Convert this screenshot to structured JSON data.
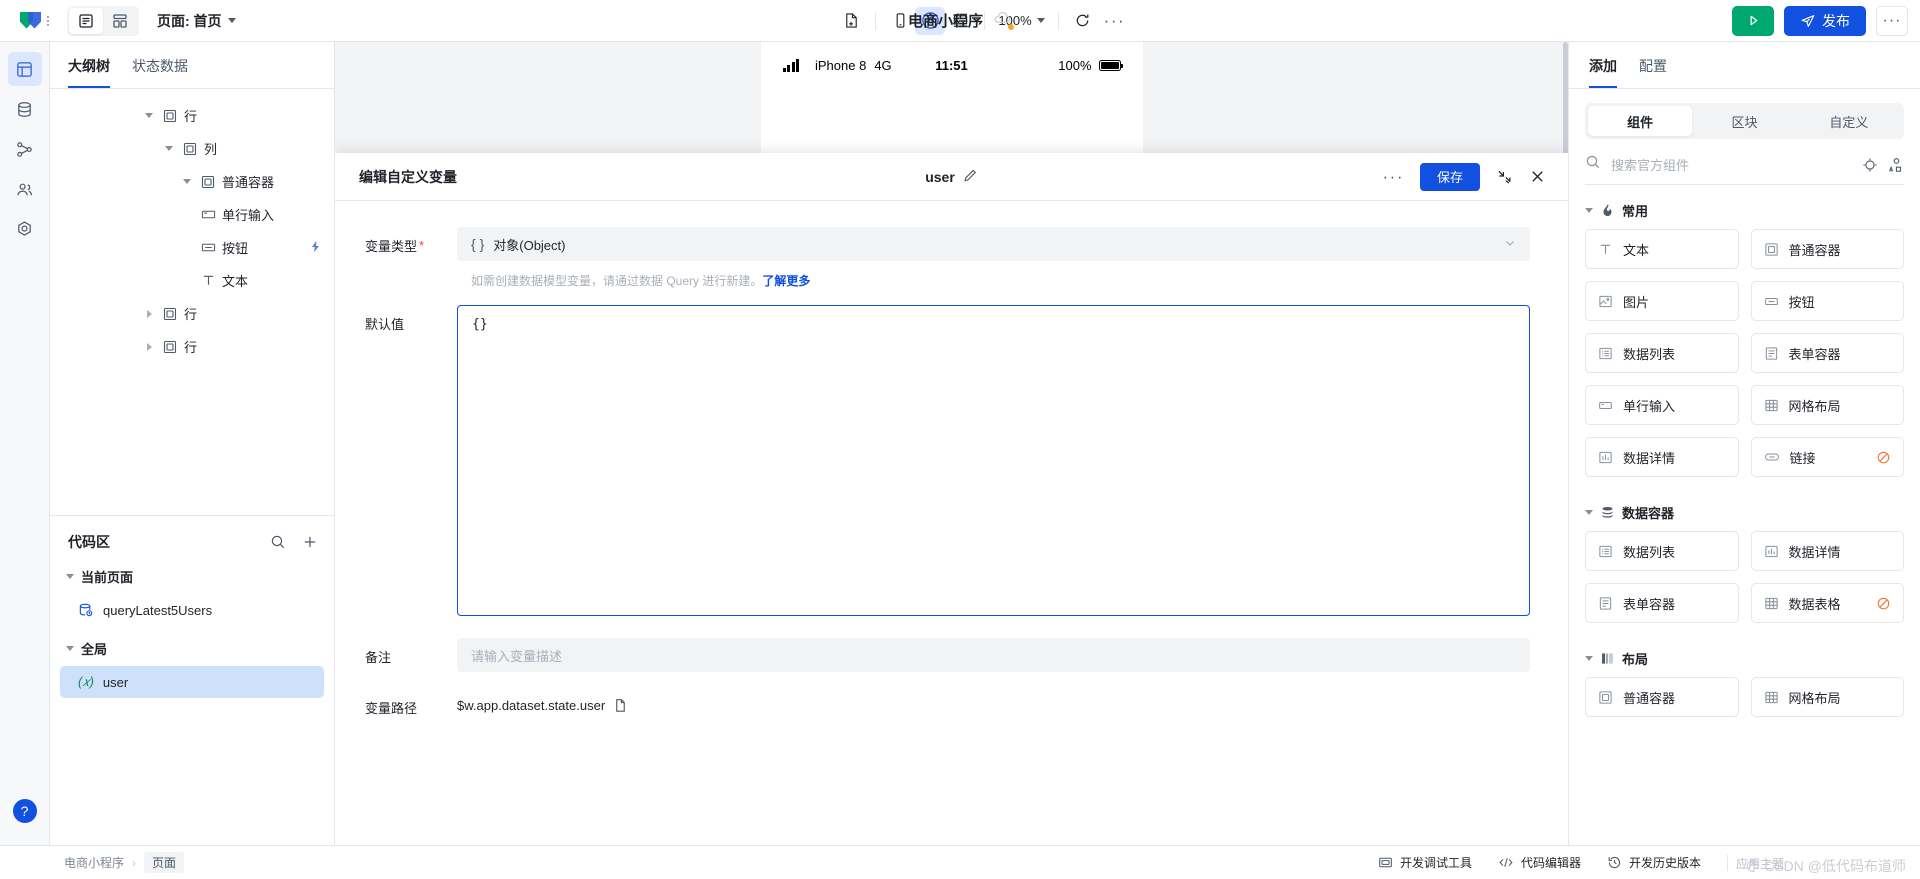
{
  "topbar": {
    "logo_icon": "logo-icon",
    "menu_dots_icon": "menu-dots-icon",
    "view_outline_icon": "view-outline-icon",
    "view_grid_icon": "view-grid-icon",
    "page_label": "页面: 首页",
    "new_page_icon": "new-page-icon",
    "device_mobile_icon": "device-mobile-icon",
    "device_miniapp_icon": "device-miniapp-icon",
    "device_desktop_icon": "device-desktop-icon",
    "zoom_level": "100%",
    "refresh_icon": "refresh-icon",
    "more_icon": "more-horizontal-icon",
    "app_title": "电商小程序",
    "cloud_icon": "cloud-icon",
    "run_icon": "play-icon",
    "publish_label": "发布",
    "publish_icon": "send-icon",
    "more_square_icon": "more-horizontal-icon"
  },
  "rail": {
    "items": [
      {
        "name": "pages",
        "icon": "pages-icon",
        "active": true
      },
      {
        "name": "data",
        "icon": "database-icon",
        "active": false
      },
      {
        "name": "flows",
        "icon": "workflow-icon",
        "active": false
      },
      {
        "name": "users",
        "icon": "users-icon",
        "active": false
      },
      {
        "name": "settings",
        "icon": "hexagon-settings-icon",
        "active": false
      }
    ],
    "help_label": "?"
  },
  "left_panel": {
    "tabs": [
      {
        "label": "大纲树",
        "active": true
      },
      {
        "label": "状态数据",
        "active": false
      }
    ],
    "tree": [
      {
        "label": "行",
        "icon": "container-icon",
        "indent": 1,
        "twisty": "down"
      },
      {
        "label": "列",
        "icon": "container-icon",
        "indent": 2,
        "twisty": "down"
      },
      {
        "label": "普通容器",
        "icon": "container-icon",
        "indent": 3,
        "twisty": "down"
      },
      {
        "label": "单行输入",
        "icon": "input-icon",
        "indent": 4,
        "twisty": "none"
      },
      {
        "label": "按钮",
        "icon": "button-icon",
        "indent": 4,
        "twisty": "none",
        "badge": "bolt-icon"
      },
      {
        "label": "文本",
        "icon": "text-icon",
        "indent": 4,
        "twisty": "none"
      },
      {
        "label": "行",
        "icon": "container-icon",
        "indent": 1,
        "twisty": "right"
      },
      {
        "label": "行",
        "icon": "container-icon",
        "indent": 1,
        "twisty": "right"
      }
    ],
    "code_section": {
      "title": "代码区",
      "search_icon": "search-icon",
      "add_icon": "plus-icon",
      "groups": [
        {
          "label": "当前页面",
          "items": [
            {
              "label": "queryLatest5Users",
              "icon": "query-icon",
              "selected": false
            }
          ]
        },
        {
          "label": "全局",
          "items": [
            {
              "label": "user",
              "icon": "variable-icon",
              "selected": true
            }
          ]
        }
      ]
    }
  },
  "phone_preview": {
    "signal_icon": "signal-bars-icon",
    "device": "iPhone 8",
    "network": "4G",
    "time": "11:51",
    "battery_percent": "100%",
    "battery_icon": "battery-icon"
  },
  "modal": {
    "title": "编辑自定义变量",
    "variable_name": "user",
    "edit_icon": "pencil-icon",
    "more_icon": "more-horizontal-icon",
    "save_label": "保存",
    "minimize_icon": "collapse-icon",
    "close_icon": "close-icon",
    "fields": {
      "type_label": "变量类型",
      "type_required": "*",
      "type_value": "对象(Object)",
      "type_prefix": "{ }",
      "chevron_icon": "chevron-down-icon",
      "hint_text": "如需创建数据模型变量，请通过数据 Query 进行新建。",
      "hint_link": "了解更多",
      "default_label": "默认值",
      "default_value": "{}",
      "note_label": "备注",
      "note_placeholder": "请输入变量描述",
      "path_label": "变量路径",
      "path_value": "$w.app.dataset.state.user",
      "copy_icon": "copy-icon"
    }
  },
  "right_panel": {
    "tabs": [
      {
        "label": "添加",
        "active": true
      },
      {
        "label": "配置",
        "active": false
      }
    ],
    "segments": [
      {
        "label": "组件",
        "active": true
      },
      {
        "label": "区块",
        "active": false
      },
      {
        "label": "自定义",
        "active": false
      }
    ],
    "search_placeholder": "搜索官方组件",
    "search_icon": "search-icon",
    "target_icon": "target-icon",
    "shapes_icon": "shapes-icon",
    "groups": [
      {
        "label": "常用",
        "icon": "fire-icon",
        "items": [
          {
            "label": "文本",
            "icon": "text-icon"
          },
          {
            "label": "普通容器",
            "icon": "container-icon"
          },
          {
            "label": "图片",
            "icon": "image-icon"
          },
          {
            "label": "按钮",
            "icon": "button-icon"
          },
          {
            "label": "数据列表",
            "icon": "list-icon"
          },
          {
            "label": "表单容器",
            "icon": "form-icon"
          },
          {
            "label": "单行输入",
            "icon": "input-icon"
          },
          {
            "label": "网格布局",
            "icon": "grid-icon"
          },
          {
            "label": "数据详情",
            "icon": "chart-icon"
          },
          {
            "label": "链接",
            "icon": "link-icon",
            "badge": "no-entry-icon"
          }
        ]
      },
      {
        "label": "数据容器",
        "icon": "database-icon",
        "items": [
          {
            "label": "数据列表",
            "icon": "list-icon"
          },
          {
            "label": "数据详情",
            "icon": "chart-icon"
          },
          {
            "label": "表单容器",
            "icon": "form-icon"
          },
          {
            "label": "数据表格",
            "icon": "table-icon",
            "badge": "no-entry-icon"
          }
        ]
      },
      {
        "label": "布局",
        "icon": "layout-icon",
        "items": [
          {
            "label": "普通容器",
            "icon": "container-icon"
          },
          {
            "label": "网格布局",
            "icon": "grid-icon"
          }
        ]
      }
    ]
  },
  "statusbar": {
    "breadcrumb": [
      {
        "label": "电商小程序",
        "current": false
      },
      {
        "label": "页面",
        "current": true
      }
    ],
    "separator": "›",
    "actions": [
      {
        "label": "开发调试工具",
        "icon": "debug-icon"
      },
      {
        "label": "代码编辑器",
        "icon": "code-icon"
      },
      {
        "label": "开发历史版本",
        "icon": "history-icon"
      }
    ],
    "watermark": "CSDN @低代码布道师",
    "watermark_overlay": "应用主题",
    "watermark_icon": "palette-icon"
  },
  "colors": {
    "accent": "#1250e0",
    "success": "#00a870",
    "warning": "#f77234",
    "danger": "#f53f3f",
    "selected_bg": "#cfe0fb"
  }
}
